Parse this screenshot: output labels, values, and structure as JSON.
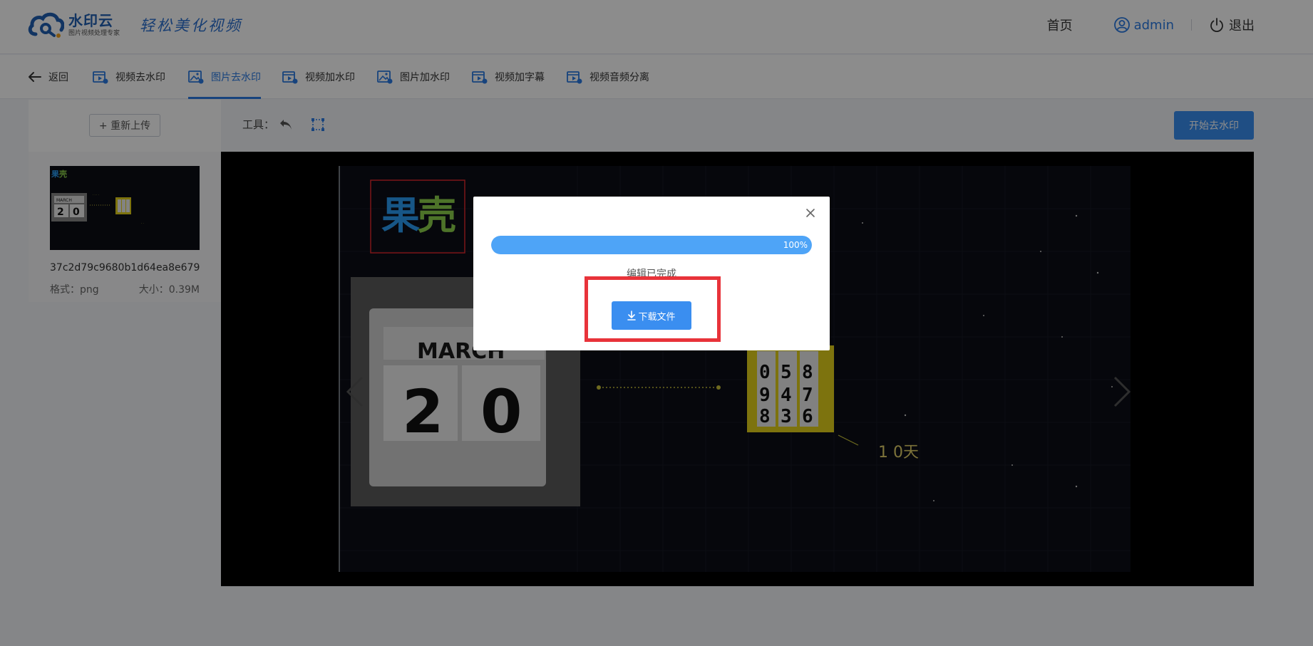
{
  "header": {
    "logo_name": "水印云",
    "logo_sub": "图片视频处理专家",
    "slogan": "轻松美化视频",
    "nav_home": "首页",
    "username": "admin",
    "logout": "退出"
  },
  "tabs": [
    {
      "label": "返回",
      "icon": "back-arrow-icon"
    },
    {
      "label": "视频去水印",
      "icon": "video-icon"
    },
    {
      "label": "图片去水印",
      "icon": "image-icon",
      "active": true
    },
    {
      "label": "视频加水印",
      "icon": "video-icon"
    },
    {
      "label": "图片加水印",
      "icon": "image-icon"
    },
    {
      "label": "视频加字幕",
      "icon": "video-icon"
    },
    {
      "label": "视频音频分离",
      "icon": "video-icon"
    }
  ],
  "left_panel": {
    "reupload_label": "+ 重新上传",
    "file_name": "37c2d79c9680b1d64ea8e679...",
    "format_label": "格式：png",
    "size_label": "大小：0.39M"
  },
  "toolbar": {
    "tools_label": "工具：",
    "start_label": "开始去水印"
  },
  "canvas": {
    "logo_left": "果",
    "logo_right": "壳",
    "month": "MARCH",
    "day_digit_1": "2",
    "day_digit_2": "0",
    "counter_label": "1 0天"
  },
  "modal": {
    "progress_percent": 100,
    "progress_text": "100%",
    "status_text": "编辑已完成",
    "download_label": "下载文件"
  },
  "colors": {
    "accent": "#2a7be4",
    "button": "#3a8ef0",
    "progress": "#4ea4f7",
    "highlight": "#e8333a"
  }
}
